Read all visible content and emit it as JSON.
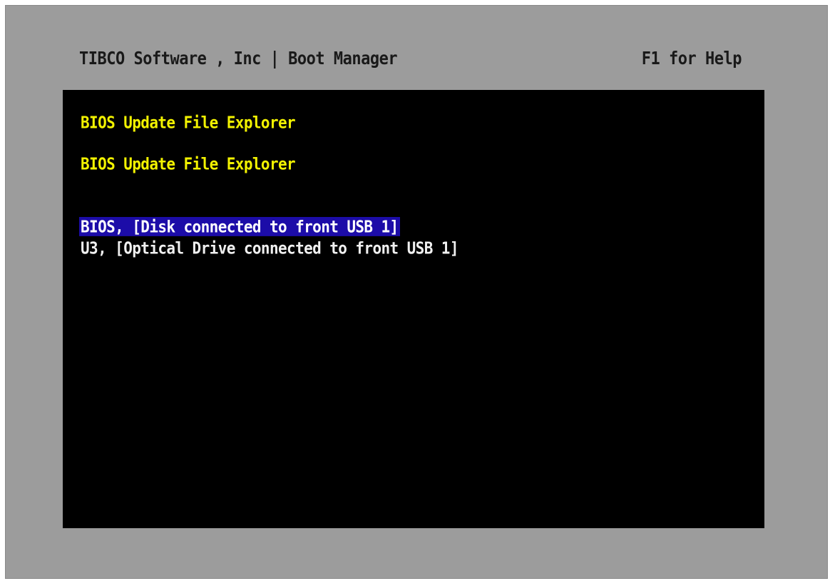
{
  "header": {
    "title": "TIBCO Software , Inc | Boot Manager",
    "help": "F1 for Help"
  },
  "panel": {
    "heading1": "BIOS Update File Explorer",
    "heading2": "BIOS Update File Explorer",
    "items": [
      {
        "label": "BIOS, [Disk connected to front USB 1]",
        "selected": true
      },
      {
        "label": "U3, [Optical Drive connected to front USB 1]",
        "selected": false
      }
    ]
  },
  "colors": {
    "frame": "#9c9c9c",
    "panel": "#000000",
    "heading": "#f2f200",
    "selection": "#1c0ca8",
    "item": "#f0f0f0"
  }
}
